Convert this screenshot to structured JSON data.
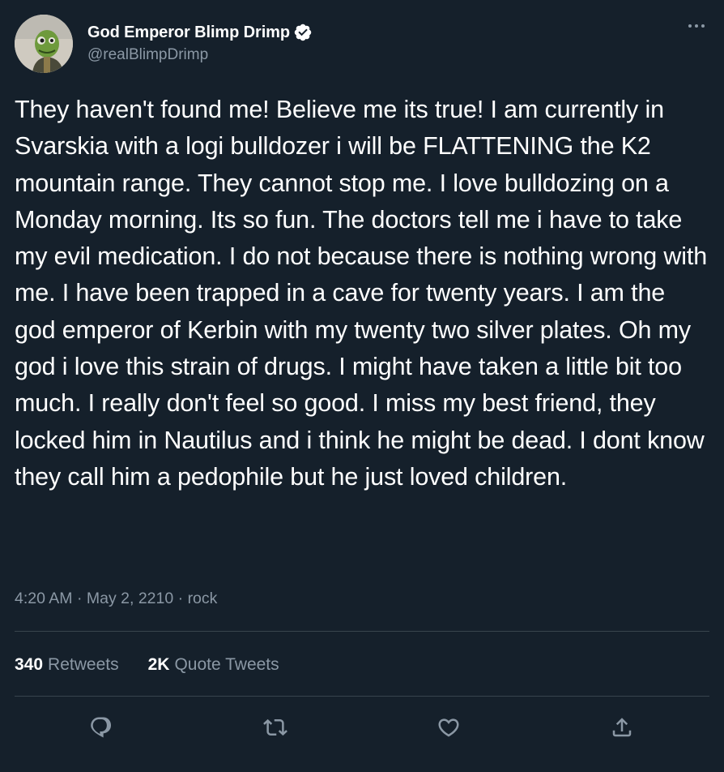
{
  "author": {
    "display_name": "God Emperor Blimp Drimp",
    "handle": "@realBlimpDrimp",
    "avatar_icon": "avatar-icon",
    "verified_icon": "verified-badge-icon"
  },
  "menu": {
    "more_icon": "more-options-icon"
  },
  "tweet": {
    "text": "They haven't found me! Believe me its true! I am currently in Svarskia with a logi bulldozer i will be FLATTENING the K2 mountain range. They cannot stop me. I love bulldozing on a Monday morning. Its so fun. The doctors tell me i have to take my evil medication. I do not because there is nothing wrong with me. I have been trapped in a cave for twenty years. I am the god emperor of Kerbin with my twenty two silver plates. Oh my god i love this strain of drugs. I might have taken a little bit too much. I really don't feel so good. I miss my best friend, they locked him in Nautilus and i think he might be dead. I dont know they call him a pedophile but he just loved children.",
    "time": "4:20 AM",
    "separator": "·",
    "date": "May 2, 2210",
    "source": "rock"
  },
  "stats": {
    "retweets_count": "340",
    "retweets_label": "Retweets",
    "quotes_count": "2K",
    "quotes_label": "Quote Tweets"
  },
  "actions": {
    "reply_icon": "reply-icon",
    "retweet_icon": "retweet-icon",
    "like_icon": "like-icon",
    "share_icon": "share-icon"
  },
  "colors": {
    "background": "#15202b",
    "text": "#ffffff",
    "secondary_text": "#8b98a5",
    "divider": "#38444d"
  }
}
